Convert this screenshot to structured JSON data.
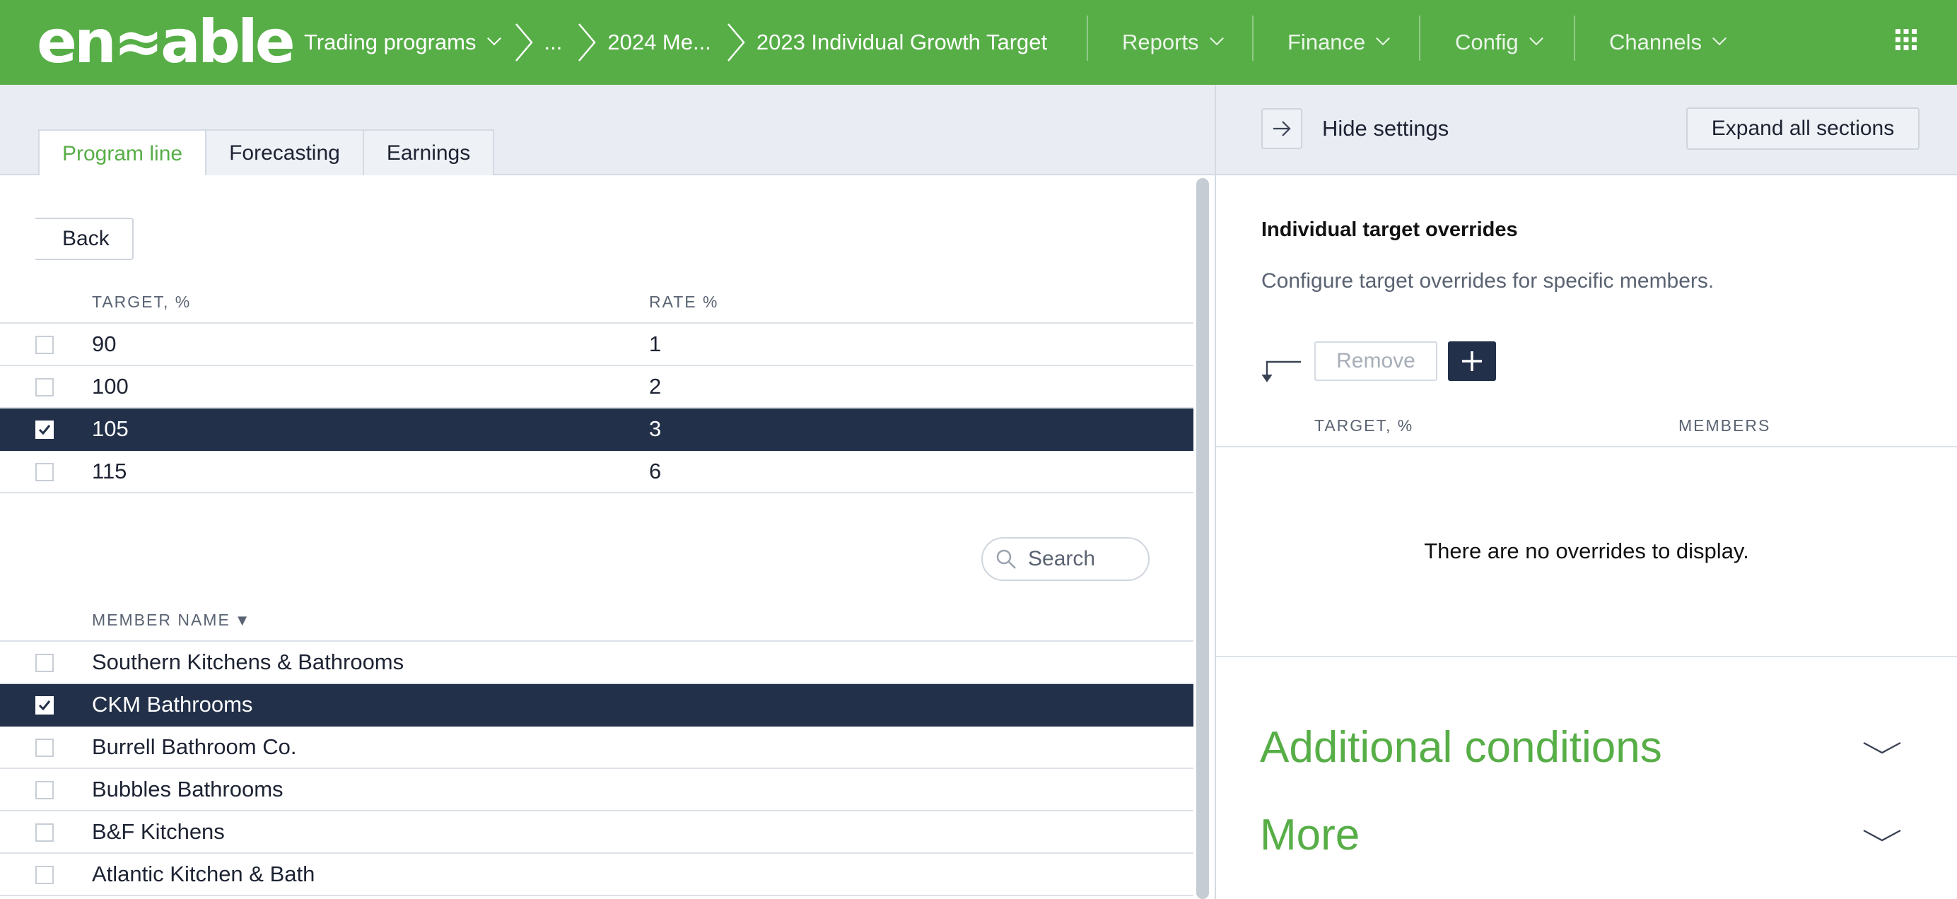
{
  "brand": {
    "logo_text": "enable",
    "accent": "#57ae47",
    "dark": "#223049"
  },
  "breadcrumb": {
    "program": "Trading programs",
    "ellipsis": "...",
    "parent": "2024 Me...",
    "current": "2023 Individual Growth Target"
  },
  "nav": {
    "reports": "Reports",
    "finance": "Finance",
    "config": "Config",
    "channels": "Channels"
  },
  "tabs": [
    {
      "label": "Program line",
      "active": true
    },
    {
      "label": "Forecasting",
      "active": false
    },
    {
      "label": "Earnings",
      "active": false
    }
  ],
  "back_label": "Back",
  "targets_table": {
    "headers": {
      "target": "TARGET, %",
      "rate": "RATE %"
    },
    "rows": [
      {
        "target": "90",
        "rate": "1",
        "checked": false
      },
      {
        "target": "100",
        "rate": "2",
        "checked": false
      },
      {
        "target": "105",
        "rate": "3",
        "checked": true
      },
      {
        "target": "115",
        "rate": "6",
        "checked": false
      }
    ]
  },
  "search": {
    "placeholder": "Search"
  },
  "members_table": {
    "header": "MEMBER NAME",
    "sort_indicator": "▼",
    "rows": [
      {
        "name": "Southern Kitchens & Bathrooms",
        "checked": false
      },
      {
        "name": "CKM Bathrooms",
        "checked": true
      },
      {
        "name": "Burrell Bathroom Co.",
        "checked": false
      },
      {
        "name": "Bubbles Bathrooms",
        "checked": false
      },
      {
        "name": "B&F Kitchens",
        "checked": false
      },
      {
        "name": "Atlantic Kitchen & Bath",
        "checked": false
      }
    ]
  },
  "settings": {
    "hide_label": "Hide settings",
    "expand_label": "Expand all sections",
    "section_title": "Individual target overrides",
    "section_desc": "Configure target overrides for specific members.",
    "remove_label": "Remove",
    "overrides_headers": {
      "target": "TARGET, %",
      "members": "MEMBERS"
    },
    "empty_message": "There are no overrides to display.",
    "additional_conditions": "Additional conditions",
    "more": "More"
  }
}
